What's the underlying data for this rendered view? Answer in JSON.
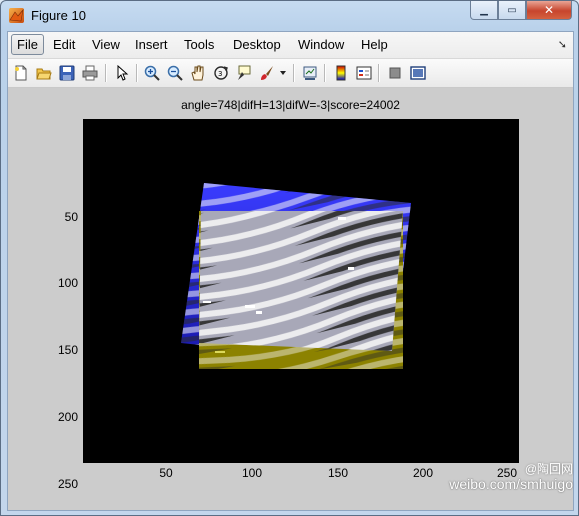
{
  "window": {
    "title": "Figure 10"
  },
  "menu": [
    {
      "label": "File"
    },
    {
      "label": "Edit"
    },
    {
      "label": "View"
    },
    {
      "label": "Insert"
    },
    {
      "label": "Tools"
    },
    {
      "label": "Desktop"
    },
    {
      "label": "Window"
    },
    {
      "label": "Help"
    }
  ],
  "toolbar": [
    "new-figure-icon",
    "open-file-icon",
    "save-icon",
    "print-icon",
    "pointer-icon",
    "zoom-in-icon",
    "zoom-out-icon",
    "pan-hand-icon",
    "rotate-3d-icon",
    "data-cursor-icon",
    "brush-icon",
    "link-plot-icon",
    "colorbar-icon",
    "legend-icon",
    "hide-plot-tools-icon",
    "show-plot-tools-icon"
  ],
  "plot": {
    "title": "angle=748|difH=13|difW=-3|score=24002",
    "yticks": [
      "50",
      "100",
      "150",
      "200",
      "250"
    ],
    "xticks": [
      "50",
      "100",
      "150",
      "200",
      "250"
    ]
  },
  "watermark": {
    "line1": "@陶回网",
    "line2": "weibo.com/smhuigo"
  }
}
